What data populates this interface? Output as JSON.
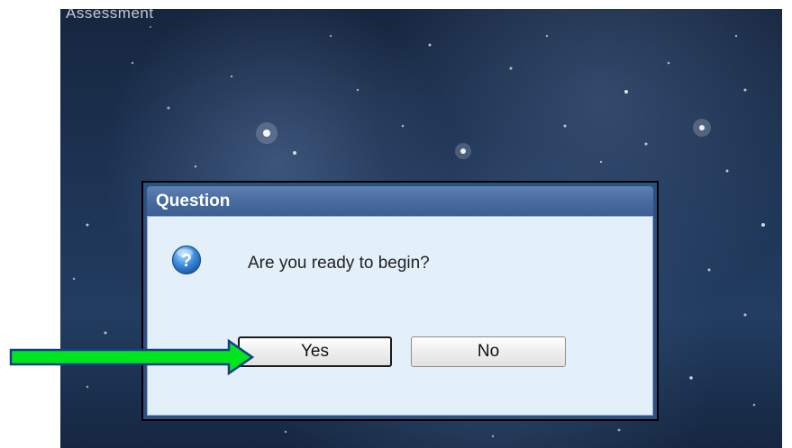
{
  "screen": {
    "title": "Assessment"
  },
  "dialog": {
    "title": "Question",
    "message": "Are you ready to begin?",
    "icon": "question-icon",
    "buttons": {
      "yes_label": "Yes",
      "no_label": "No"
    }
  },
  "annotation": {
    "arrow_color": "#00e61e",
    "arrow_outline_color": "#1a3a8a",
    "points_to": "yes-button"
  },
  "colors": {
    "titlebar": "#476a9e",
    "dialog_body": "#e3f0fa",
    "background": "#1e3556"
  }
}
